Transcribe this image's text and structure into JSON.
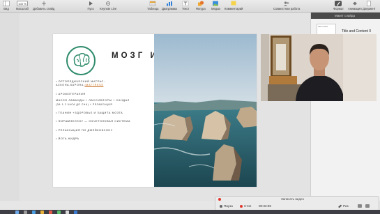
{
  "toolbar": {
    "left": [
      {
        "label": "Вид",
        "icon": "sidebar-icon"
      },
      {
        "label": "Масштаб",
        "value": "100 %"
      },
      {
        "label": "Добавить слайд",
        "icon": "plus-icon"
      }
    ],
    "center": [
      {
        "label": "Пуск",
        "icon": "play-icon"
      },
      {
        "label": "Keynote Live",
        "icon": "keynote-live-icon"
      }
    ],
    "insert": [
      {
        "label": "Таблица",
        "icon": "table-icon"
      },
      {
        "label": "Диаграмма",
        "icon": "chart-icon"
      },
      {
        "label": "Текст",
        "icon": "text-icon"
      },
      {
        "label": "Фигура",
        "icon": "shape-icon"
      },
      {
        "label": "Медиа",
        "icon": "media-icon"
      },
      {
        "label": "Комментарий",
        "icon": "comment-icon"
      }
    ],
    "collab": {
      "label": "Совместная работа",
      "icon": "collaborate-icon"
    },
    "right": [
      {
        "label": "Формат",
        "icon": "format-icon",
        "active": true
      },
      {
        "label": "Анимация",
        "icon": "animate-icon"
      },
      {
        "label": "Документ",
        "icon": "document-icon"
      }
    ]
  },
  "sidepanel": {
    "header": "Макет слайда",
    "thumb_caption": "Заголовок",
    "layout_name": "Title and Content 0"
  },
  "slide": {
    "title": "МОЗГ И СОН",
    "bullets": [
      {
        "lines": [
          "• ОРТОПЕДИЧЕСКИЙ МАТРАС:",
          "АСКОНА,КАРОНА,"
        ],
        "link": "IMATTRESS"
      },
      {
        "lines": [
          "• АРОМОТЕРАПИЯ"
        ]
      },
      {
        "lines": [
          "МАСЛО ЛАВАНДЫ + ЛАССИФЛОРЫ + САНДАЛ",
          "(ЗА 1-2 ЧАСА ДО СНА) + РЕЛАКСАЦИЯ"
        ]
      },
      {
        "lines": [
          "• ТЕАНИН +ЗДОРОВЬЕ И ЗАЩИТА МОЗГА"
        ]
      },
      {
        "lines": [
          "• ФИРШИЗЕЛЛОУ — ОЧЧЕТОЛОВАЯ СИСТЕМА"
        ]
      },
      {
        "lines": [
          "• РЕЛАКСАЦИЯ ПО ДЖЕЙКОБСОНУ"
        ]
      },
      {
        "lines": [
          "• ЙОГА НИДРА"
        ]
      }
    ]
  },
  "recorder": {
    "title": "Записать видео",
    "pause": "Пауза",
    "stop": "Стоп",
    "time": "00:32:08",
    "draw": "Рис."
  },
  "colors": {
    "accent": "#2e8b6a",
    "link": "#c46a1d",
    "rec": "#e0372c"
  }
}
